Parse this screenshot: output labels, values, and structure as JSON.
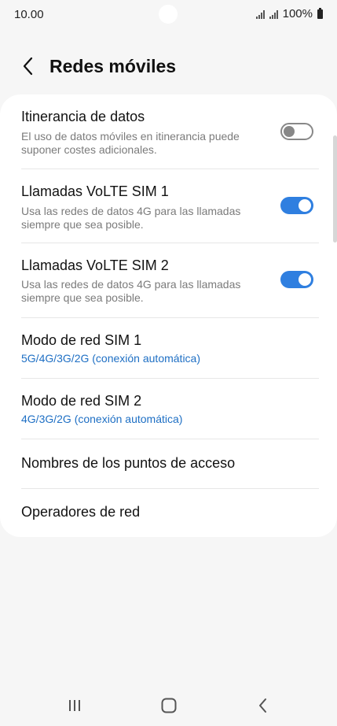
{
  "status_bar": {
    "time": "10.00",
    "battery": "100%",
    "icons": [
      "signal-icon",
      "signal-icon",
      "battery-icon"
    ]
  },
  "header": {
    "back_icon": "chevron-left-icon",
    "title": "Redes móviles"
  },
  "settings": {
    "data_roaming": {
      "title": "Itinerancia de datos",
      "subtitle": "El uso de datos móviles en itinerancia puede suponer costes adicionales.",
      "enabled": false
    },
    "volte_sim1": {
      "title": "Llamadas VoLTE SIM 1",
      "subtitle": "Usa las redes de datos 4G para las llamadas siempre que sea posible.",
      "enabled": true
    },
    "volte_sim2": {
      "title": "Llamadas VoLTE SIM 2",
      "subtitle": "Usa las redes de datos 4G para las llamadas siempre que sea posible.",
      "enabled": true
    },
    "network_mode_sim1": {
      "title": "Modo de red SIM 1",
      "value": "5G/4G/3G/2G (conexión automática)"
    },
    "network_mode_sim2": {
      "title": "Modo de red SIM 2",
      "value": "4G/3G/2G (conexión automática)"
    },
    "apn": {
      "title": "Nombres de los puntos de acceso"
    },
    "operators": {
      "title": "Operadores de red"
    }
  },
  "nav": {
    "recents_icon": "recent-apps-icon",
    "home_icon": "home-icon",
    "back_icon": "back-icon"
  },
  "colors": {
    "accent": "#2f7fe0",
    "link_blue": "#1e6fc4",
    "background": "#f6f6f6",
    "card": "#ffffff"
  }
}
